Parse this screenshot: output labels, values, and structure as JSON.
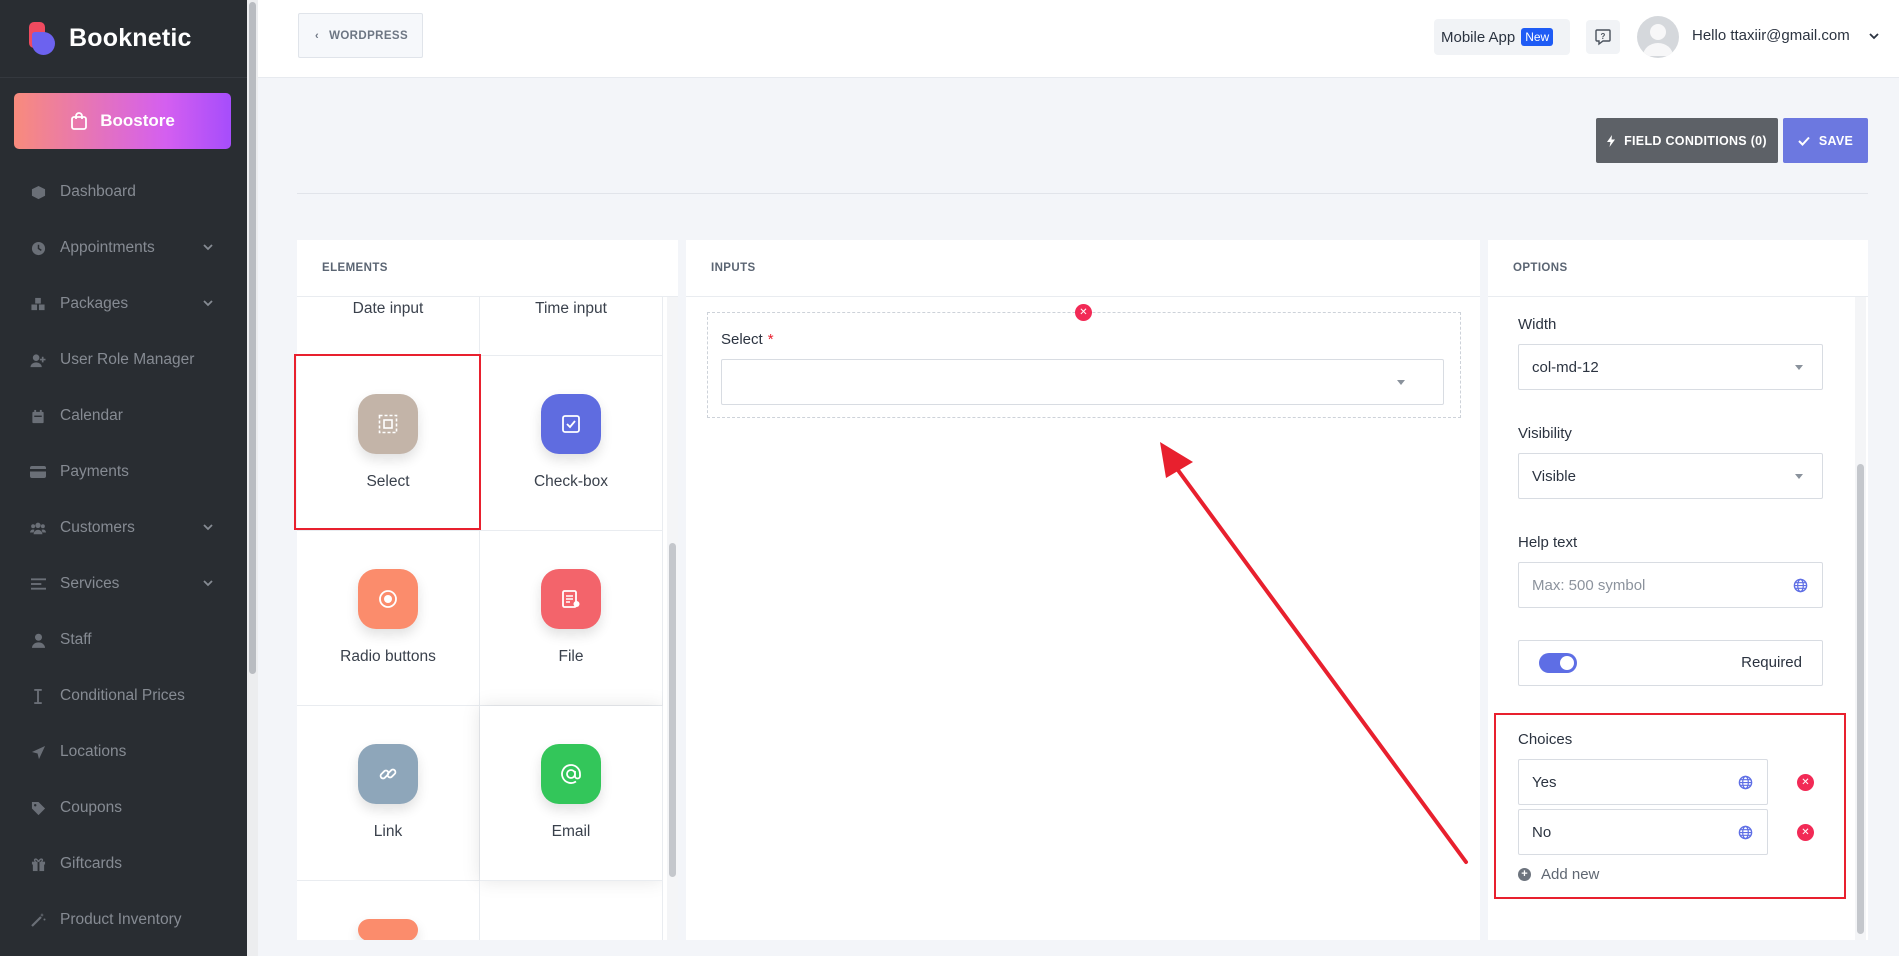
{
  "sidebar": {
    "brand": "Booknetic",
    "boostore": "Boostore",
    "items": [
      {
        "label": "Dashboard",
        "icon": "dashboard-icon",
        "has_chevron": false
      },
      {
        "label": "Appointments",
        "icon": "clock-icon",
        "has_chevron": true
      },
      {
        "label": "Packages",
        "icon": "packages-icon",
        "has_chevron": true
      },
      {
        "label": "User Role Manager",
        "icon": "user-plus-icon",
        "has_chevron": false
      },
      {
        "label": "Calendar",
        "icon": "calendar-icon",
        "has_chevron": false
      },
      {
        "label": "Payments",
        "icon": "credit-card-icon",
        "has_chevron": false
      },
      {
        "label": "Customers",
        "icon": "users-icon",
        "has_chevron": true
      },
      {
        "label": "Services",
        "icon": "list-icon",
        "has_chevron": true
      },
      {
        "label": "Staff",
        "icon": "user-icon",
        "has_chevron": false
      },
      {
        "label": "Conditional Prices",
        "icon": "cursor-icon",
        "has_chevron": false
      },
      {
        "label": "Locations",
        "icon": "location-arrow-icon",
        "has_chevron": false
      },
      {
        "label": "Coupons",
        "icon": "tag-icon",
        "has_chevron": false
      },
      {
        "label": "Giftcards",
        "icon": "gift-icon",
        "has_chevron": false
      },
      {
        "label": "Product Inventory",
        "icon": "magic-wand-icon",
        "has_chevron": false
      }
    ]
  },
  "topbar": {
    "back_label": "WORDPRESS",
    "mobile_app": "Mobile App",
    "new_badge": "New",
    "hello": "Hello ttaxiir@gmail.com"
  },
  "actions": {
    "field_conditions": "FIELD CONDITIONS (0)",
    "save": "SAVE"
  },
  "elements": {
    "title": "ELEMENTS",
    "items": [
      {
        "label": "Date input",
        "color": null
      },
      {
        "label": "Time input",
        "color": null
      },
      {
        "label": "Select",
        "color": "#c3b4a8"
      },
      {
        "label": "Check-box",
        "color": "#5f6ce0"
      },
      {
        "label": "Radio buttons",
        "color": "#fb8c6c"
      },
      {
        "label": "File",
        "color": "#f3646b"
      },
      {
        "label": "Link",
        "color": "#8ea6ba"
      },
      {
        "label": "Email",
        "color": "#33c65a"
      }
    ],
    "partial_color": "#fb8c6c"
  },
  "inputs": {
    "title": "INPUTS",
    "select_label": "Select",
    "required_mark": "*"
  },
  "options": {
    "title": "OPTIONS",
    "width_label": "Width",
    "width_value": "col-md-12",
    "visibility_label": "Visibility",
    "visibility_value": "Visible",
    "help_label": "Help text",
    "help_placeholder": "Max: 500 symbol",
    "required_label": "Required",
    "choices_label": "Choices",
    "choices": [
      "Yes",
      "No"
    ],
    "add_new": "Add new"
  },
  "colors": {
    "sidebar_bg": "#292d32",
    "accent": "#6c78e0",
    "danger": "#f22a56",
    "highlight": "#e8202e"
  }
}
